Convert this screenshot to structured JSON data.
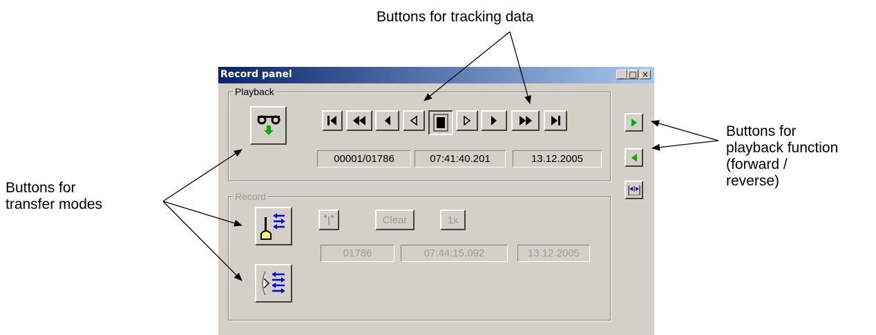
{
  "callouts": {
    "tracking": "Buttons for tracking data",
    "playback_line1": "Buttons for",
    "playback_line2": "playback function",
    "playback_line3": "(forward /",
    "playback_line4": "reverse)",
    "transfer_line1": "Buttons for",
    "transfer_line2": "transfer modes"
  },
  "window": {
    "title": "Record panel",
    "min_label": "_",
    "max_label": "□",
    "close_label": "×"
  },
  "playback": {
    "legend": "Playback",
    "record_index": "00001/01786",
    "time": "07:41:40.201",
    "date": "13.12.2005",
    "nav_icons": [
      "skip-to-start-icon",
      "fast-rewind-icon",
      "step-back-icon",
      "step-back-outline-icon",
      "stop-icon",
      "step-forward-outline-icon",
      "step-forward-icon",
      "fast-forward-icon",
      "skip-to-end-icon"
    ]
  },
  "record": {
    "legend": "Record",
    "clear_label": "Clear",
    "speed_label": "1x",
    "count": "01786",
    "time": "07:44:15.092",
    "date": "13.12.2005"
  },
  "side_buttons": [
    "play-forward-icon",
    "play-reverse-icon",
    "fit-range-icon"
  ],
  "colors": {
    "titlebar_start": "#0a246a",
    "titlebar_end": "#a6caf0",
    "face": "#d4d0c8",
    "play_green": "#00b000",
    "transfer_blue": "#0000dd",
    "yellow": "#ffff66"
  }
}
